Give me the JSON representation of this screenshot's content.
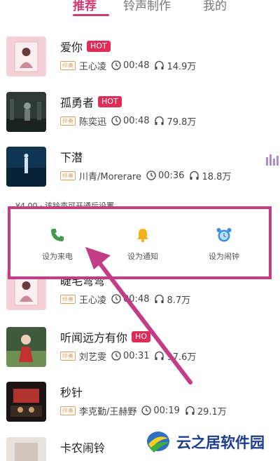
{
  "tabs": [
    {
      "label": "推荐",
      "active": true
    },
    {
      "label": "铃声制作",
      "active": false
    },
    {
      "label": "我的",
      "active": false
    }
  ],
  "songs": [
    {
      "title": "爱你",
      "hot": "HOT",
      "badge": "伴奏",
      "artist": "王心凌",
      "duration": "00:48",
      "plays": "14.9万"
    },
    {
      "title": "孤勇者",
      "hot": "HOT",
      "badge": "伴奏",
      "artist": "陈奕迅",
      "duration": "00:48",
      "plays": "79.8万"
    },
    {
      "title": "下潜",
      "hot": "",
      "badge": "伴奏",
      "artist": "川青/Morerare",
      "duration": "00:36",
      "plays": "18.8万"
    },
    {
      "title": "睫毛弯弯",
      "hot": "",
      "badge": "伴奏",
      "artist": "王心凌",
      "duration": "00:48",
      "plays": "8.7万"
    },
    {
      "title": "听闻远方有你",
      "hot": "HO",
      "badge": "伴奏",
      "artist": "刘艺雯",
      "duration": "00:31",
      "plays": "97.6万"
    },
    {
      "title": "秒针",
      "hot": "",
      "badge": "伴奏",
      "artist": "李克勤/王赫野",
      "duration": "00:19",
      "plays": "29.1万"
    },
    {
      "title": "卡农闹铃",
      "hot": "",
      "badge": "",
      "artist": "",
      "duration": "",
      "plays": ""
    }
  ],
  "actions": [
    {
      "label": "设为来电",
      "icon": "phone-icon",
      "color": "#3f9a4a"
    },
    {
      "label": "设为通知",
      "icon": "bell-icon",
      "color": "#f2b21c"
    },
    {
      "label": "设为闹钟",
      "icon": "alarm-clock-icon",
      "color": "#3a8fe0"
    }
  ],
  "drop_caption": "¥4.00 · 该铃声可开通后设置",
  "watermark": {
    "text": "云之居软件园"
  },
  "colors": {
    "accent": "#d23a72",
    "hot": "#e02d58",
    "highlight": "#c23d86"
  }
}
